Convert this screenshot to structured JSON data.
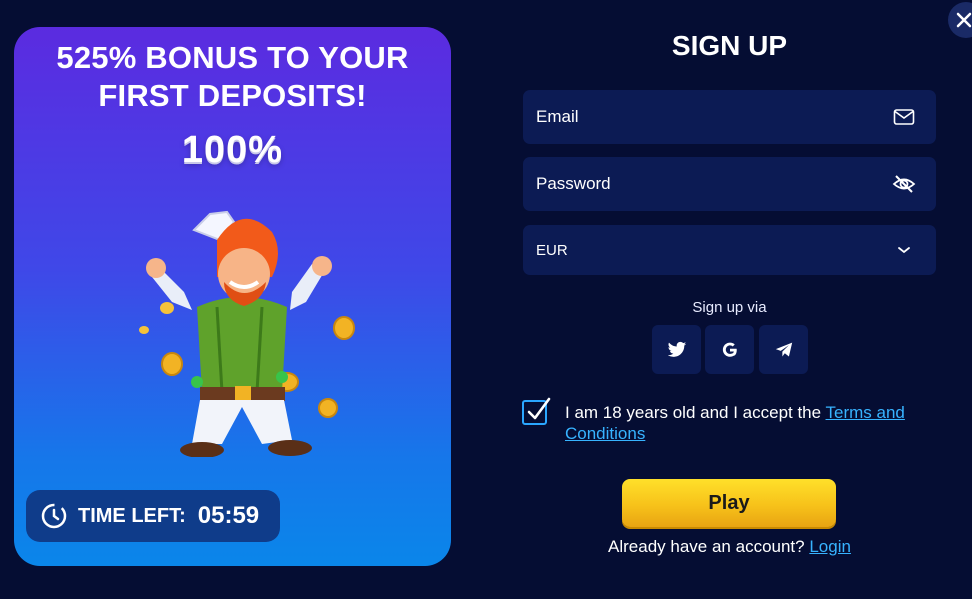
{
  "promo": {
    "title_line1": "525% BONUS TO YOUR",
    "title_line2": "FIRST DEPOSITS!",
    "percent": "100%",
    "timer_label": "TIME LEFT:",
    "timer_value": "05:59"
  },
  "close": {
    "icon": "close-icon"
  },
  "form": {
    "title": "SIGN UP",
    "email_placeholder": "Email",
    "password_placeholder": "Password",
    "currency_value": "EUR",
    "via_label": "Sign up via",
    "social": [
      "twitter-icon",
      "google-icon",
      "telegram-icon"
    ],
    "terms_checked": true,
    "terms_text": "I am 18 years old and I accept the ",
    "terms_link": "Terms and Conditions",
    "play_label": "Play",
    "account_text": "Already have an account? ",
    "login_link": "Login"
  },
  "colors": {
    "background": "#050d33",
    "field": "#0c1b54",
    "link": "#37b3ff",
    "play": "#f7c21a"
  }
}
